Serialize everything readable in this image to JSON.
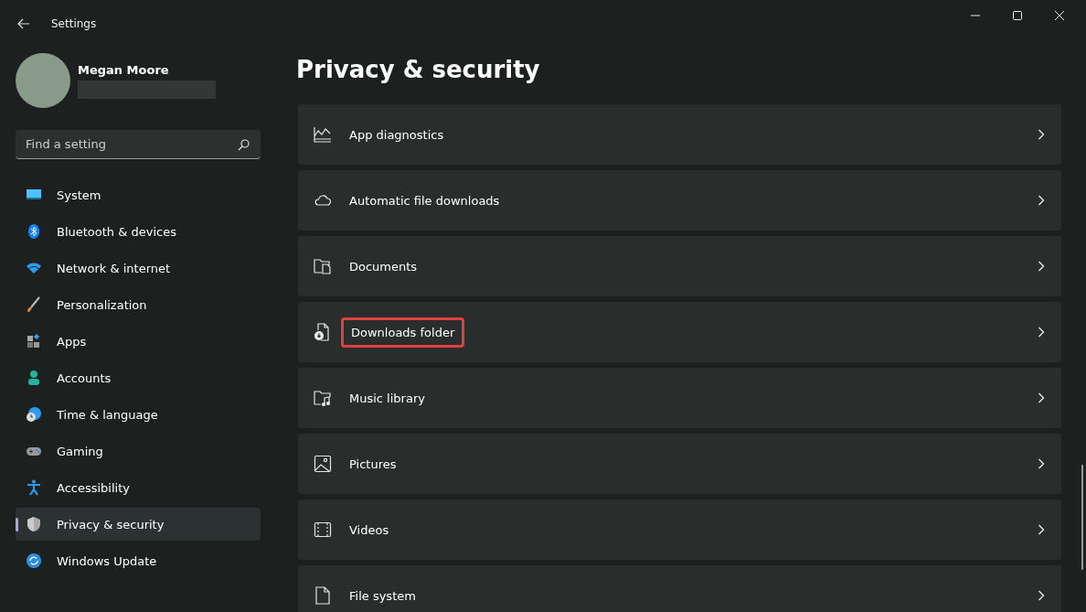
{
  "window": {
    "title": "Settings"
  },
  "profile": {
    "name": "Megan Moore"
  },
  "search": {
    "placeholder": "Find a setting"
  },
  "sidebar": {
    "items": [
      {
        "label": "System",
        "selected": false
      },
      {
        "label": "Bluetooth & devices",
        "selected": false
      },
      {
        "label": "Network & internet",
        "selected": false
      },
      {
        "label": "Personalization",
        "selected": false
      },
      {
        "label": "Apps",
        "selected": false
      },
      {
        "label": "Accounts",
        "selected": false
      },
      {
        "label": "Time & language",
        "selected": false
      },
      {
        "label": "Gaming",
        "selected": false
      },
      {
        "label": "Accessibility",
        "selected": false
      },
      {
        "label": "Privacy & security",
        "selected": true
      },
      {
        "label": "Windows Update",
        "selected": false
      }
    ]
  },
  "page": {
    "title": "Privacy & security",
    "items": [
      {
        "label": "App diagnostics",
        "highlighted": false
      },
      {
        "label": "Automatic file downloads",
        "highlighted": false
      },
      {
        "label": "Documents",
        "highlighted": false
      },
      {
        "label": "Downloads folder",
        "highlighted": true
      },
      {
        "label": "Music library",
        "highlighted": false
      },
      {
        "label": "Pictures",
        "highlighted": false
      },
      {
        "label": "Videos",
        "highlighted": false
      },
      {
        "label": "File system",
        "highlighted": false
      }
    ]
  }
}
